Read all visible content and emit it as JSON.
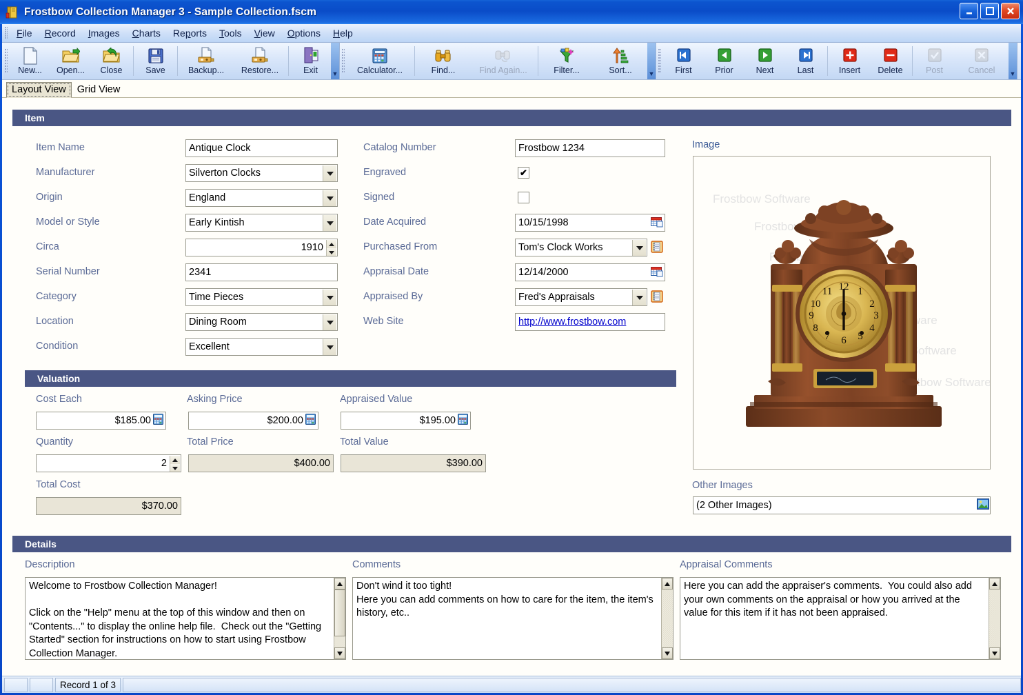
{
  "window": {
    "title": "Frostbow Collection Manager 3 - Sample Collection.fscm",
    "icon": "app-book-icon",
    "minimize_label": "_",
    "maximize_label": "□",
    "close_label": "✕"
  },
  "menubar": {
    "items": [
      {
        "label": "File",
        "accel": "F"
      },
      {
        "label": "Record",
        "accel": "R"
      },
      {
        "label": "Images",
        "accel": "I"
      },
      {
        "label": "Charts",
        "accel": "C"
      },
      {
        "label": "Reports",
        "accel": "p"
      },
      {
        "label": "Tools",
        "accel": "T"
      },
      {
        "label": "View",
        "accel": "V"
      },
      {
        "label": "Options",
        "accel": "O"
      },
      {
        "label": "Help",
        "accel": "H"
      }
    ]
  },
  "toolbar": {
    "groups": [
      {
        "name": "file-group",
        "buttons": [
          {
            "label": "New...",
            "icon": "new-document-icon",
            "enabled": true
          },
          {
            "label": "Open...",
            "icon": "open-folder-icon",
            "enabled": true
          },
          {
            "label": "Close",
            "icon": "close-folder-icon",
            "enabled": true
          },
          {
            "label": "Save",
            "icon": "save-diskette-icon",
            "enabled": true
          },
          {
            "label": "Backup...",
            "icon": "backup-icon",
            "enabled": true
          },
          {
            "label": "Restore...",
            "icon": "restore-icon",
            "enabled": true
          },
          {
            "label": "Exit",
            "icon": "exit-door-icon",
            "enabled": true
          }
        ]
      },
      {
        "name": "tools-group",
        "buttons": [
          {
            "label": "Calculator...",
            "icon": "calculator-icon",
            "enabled": true
          },
          {
            "label": "Find...",
            "icon": "binoculars-icon",
            "enabled": true
          },
          {
            "label": "Find Again...",
            "icon": "find-again-icon",
            "enabled": false
          },
          {
            "label": "Filter...",
            "icon": "funnel-icon",
            "enabled": true
          },
          {
            "label": "Sort...",
            "icon": "sort-ascending-icon",
            "enabled": true
          }
        ]
      },
      {
        "name": "record-nav-group",
        "buttons": [
          {
            "label": "First",
            "icon": "first-record-icon",
            "enabled": true
          },
          {
            "label": "Prior",
            "icon": "prior-record-icon",
            "enabled": true
          },
          {
            "label": "Next",
            "icon": "next-record-icon",
            "enabled": true
          },
          {
            "label": "Last",
            "icon": "last-record-icon",
            "enabled": true
          },
          {
            "label": "Insert",
            "icon": "insert-record-icon",
            "enabled": true
          },
          {
            "label": "Delete",
            "icon": "delete-record-icon",
            "enabled": true
          },
          {
            "label": "Post",
            "icon": "post-check-icon",
            "enabled": false
          },
          {
            "label": "Cancel",
            "icon": "cancel-x-icon",
            "enabled": false
          }
        ]
      }
    ]
  },
  "tabs": [
    {
      "label": "Layout View",
      "active": true
    },
    {
      "label": "Grid View",
      "active": false
    }
  ],
  "sections": {
    "item": {
      "title": "Item",
      "left_fields": [
        {
          "label": "Item Name",
          "value": "Antique Clock",
          "type": "text"
        },
        {
          "label": "Manufacturer",
          "value": "Silverton Clocks",
          "type": "combo"
        },
        {
          "label": "Origin",
          "value": "England",
          "type": "combo"
        },
        {
          "label": "Model or Style",
          "value": "Early Kintish",
          "type": "combo"
        },
        {
          "label": "Circa",
          "value": "1910",
          "type": "spinner"
        },
        {
          "label": "Serial Number",
          "value": "2341",
          "type": "text"
        },
        {
          "label": "Category",
          "value": "Time Pieces",
          "type": "combo"
        },
        {
          "label": "Location",
          "value": "Dining Room",
          "type": "combo"
        },
        {
          "label": "Condition",
          "value": "Excellent",
          "type": "combo"
        }
      ],
      "mid_fields": [
        {
          "label": "Catalog Number",
          "value": "Frostbow 1234",
          "type": "text"
        },
        {
          "label": "Engraved",
          "value": "checked",
          "type": "checkbox"
        },
        {
          "label": "Signed",
          "value": "unchecked",
          "type": "checkbox"
        },
        {
          "label": "Date Acquired",
          "value": "10/15/1998",
          "type": "date",
          "icon": "calendar-icon"
        },
        {
          "label": "Purchased From",
          "value": "Tom's Clock Works",
          "type": "combo-lookup",
          "icon": "address-book-icon"
        },
        {
          "label": "Appraisal Date",
          "value": "12/14/2000",
          "type": "date",
          "icon": "calendar-icon"
        },
        {
          "label": "Appraised By",
          "value": "Fred's Appraisals",
          "type": "combo-lookup",
          "icon": "address-book-icon"
        },
        {
          "label": "Web Site",
          "value": "http://www.frostbow.com",
          "type": "link"
        }
      ]
    },
    "valuation": {
      "title": "Valuation",
      "fields": [
        {
          "label": "Cost Each",
          "value": "$185.00",
          "type": "money",
          "icon": "calculator-icon",
          "readonly": false
        },
        {
          "label": "Asking Price",
          "value": "$200.00",
          "type": "money",
          "icon": "calculator-icon",
          "readonly": false
        },
        {
          "label": "Appraised Value",
          "value": "$195.00",
          "type": "money",
          "icon": "calculator-icon",
          "readonly": false
        },
        {
          "label": "Quantity",
          "value": "2",
          "type": "spinner",
          "readonly": false
        },
        {
          "label": "Total Price",
          "value": "$400.00",
          "type": "money",
          "readonly": true
        },
        {
          "label": "Total Value",
          "value": "$390.00",
          "type": "money",
          "readonly": true
        },
        {
          "label": "Total Cost",
          "value": "$370.00",
          "type": "money",
          "readonly": true
        }
      ]
    },
    "details": {
      "title": "Details",
      "fields": [
        {
          "label": "Description",
          "value": "Welcome to Frostbow Collection Manager!\n\nClick on the \"Help\" menu at the top of this window and then on \"Contents...\" to display the online help file.  Check out the \"Getting Started\" section for instructions on how to start using Frostbow Collection Manager."
        },
        {
          "label": "Comments",
          "value": "Don't wind it too tight!\nHere you can add comments on how to care for the item, the item's history, etc.."
        },
        {
          "label": "Appraisal Comments",
          "value": "Here you can add the appraiser's comments.  You could also add your own comments on the appraisal or how you arrived at the value for this item if it has not been appraised."
        }
      ]
    },
    "image": {
      "label": "Image",
      "watermark_text": "Frostbow Software",
      "other_images_label": "Other Images",
      "other_images_value": "(2 Other Images)",
      "other_images_icon": "picture-icon"
    }
  },
  "statusbar": {
    "record_text": "Record 1 of 3"
  },
  "colors": {
    "section_header_bg": "#4a5684",
    "label_text": "#5a6a96",
    "readonly_field_bg": "#e9e5d7",
    "title_bar": "#0a4cc8",
    "link": "#0000cc"
  }
}
